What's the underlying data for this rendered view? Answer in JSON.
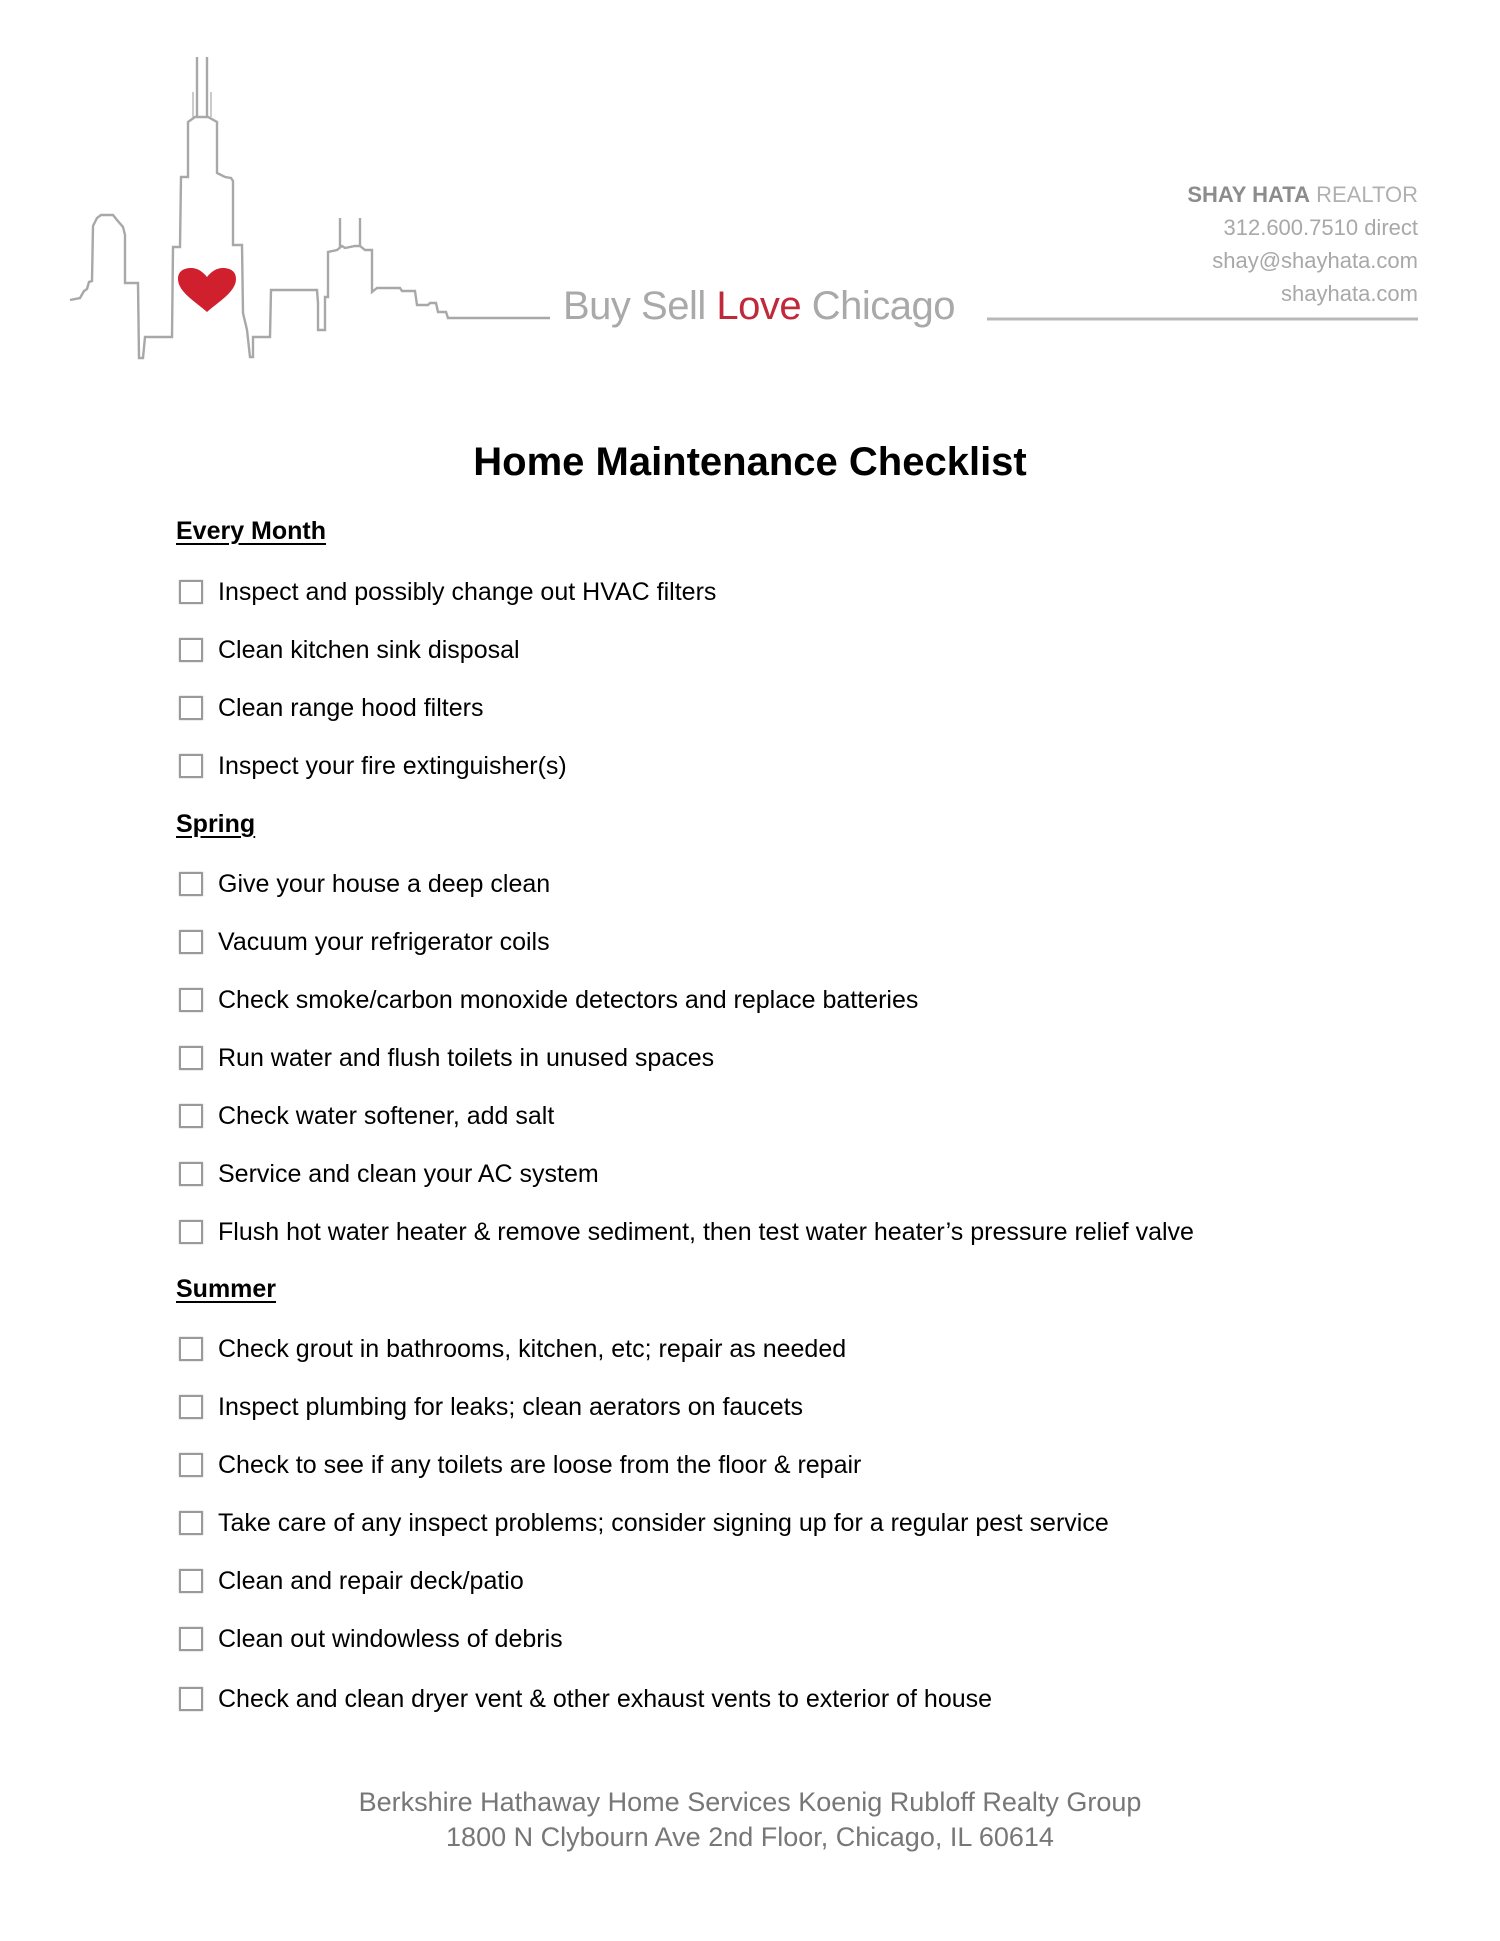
{
  "header": {
    "tagline": {
      "part1": "Buy Sell ",
      "accent": "Love",
      "part2": " Chicago"
    },
    "contact": {
      "name": "SHAY HATA",
      "role": " REALTOR",
      "phone": "312.600.7510 direct",
      "email": "shay@shayhata.com",
      "website": "shayhata.com"
    },
    "logo_icons": {
      "skyline": "chicago-skyline-icon",
      "heart": "heart-icon"
    },
    "colors": {
      "skyline": "#a8a8a8",
      "heart": "#d0202e",
      "accent": "#c0283c"
    }
  },
  "title": "Home Maintenance Checklist",
  "sections": [
    {
      "heading": "Every Month",
      "items": [
        {
          "label": "Inspect and possibly change out HVAC filters",
          "checked": false
        },
        {
          "label": "Clean kitchen sink disposal",
          "checked": false
        },
        {
          "label": "Clean range hood filters",
          "checked": false
        },
        {
          "label": "Inspect your fire extinguisher(s)",
          "checked": false
        }
      ]
    },
    {
      "heading": "Spring",
      "items": [
        {
          "label": "Give your house a deep clean",
          "checked": false
        },
        {
          "label": "Vacuum your refrigerator coils",
          "checked": false
        },
        {
          "label": "Check smoke/carbon monoxide detectors and replace batteries",
          "checked": false
        },
        {
          "label": "Run water and flush toilets in unused spaces",
          "checked": false
        },
        {
          "label": "Check water softener, add salt",
          "checked": false
        },
        {
          "label": "Service and clean your AC system",
          "checked": false
        },
        {
          "label": "Flush hot water heater & remove sediment, then test water heater’s pressure relief valve",
          "checked": false
        }
      ]
    },
    {
      "heading": "Summer",
      "items": [
        {
          "label": "Check grout in bathrooms, kitchen, etc; repair as needed",
          "checked": false
        },
        {
          "label": "Inspect plumbing for leaks; clean aerators on faucets",
          "checked": false
        },
        {
          "label": "Check to see if any toilets are loose from the floor & repair",
          "checked": false
        },
        {
          "label": "Take care of any inspect problems; consider signing up for a regular pest service",
          "checked": false
        },
        {
          "label": "Clean and repair deck/patio",
          "checked": false
        },
        {
          "label": "Clean out windowless of debris",
          "checked": false
        },
        {
          "label": "Check and clean dryer vent & other exhaust vents to exterior of house",
          "checked": false
        }
      ]
    }
  ],
  "footer": {
    "company": "Berkshire Hathaway Home Services Koenig Rubloff Realty Group",
    "address": "1800 N Clybourn Ave 2nd Floor, Chicago, IL 60614"
  }
}
